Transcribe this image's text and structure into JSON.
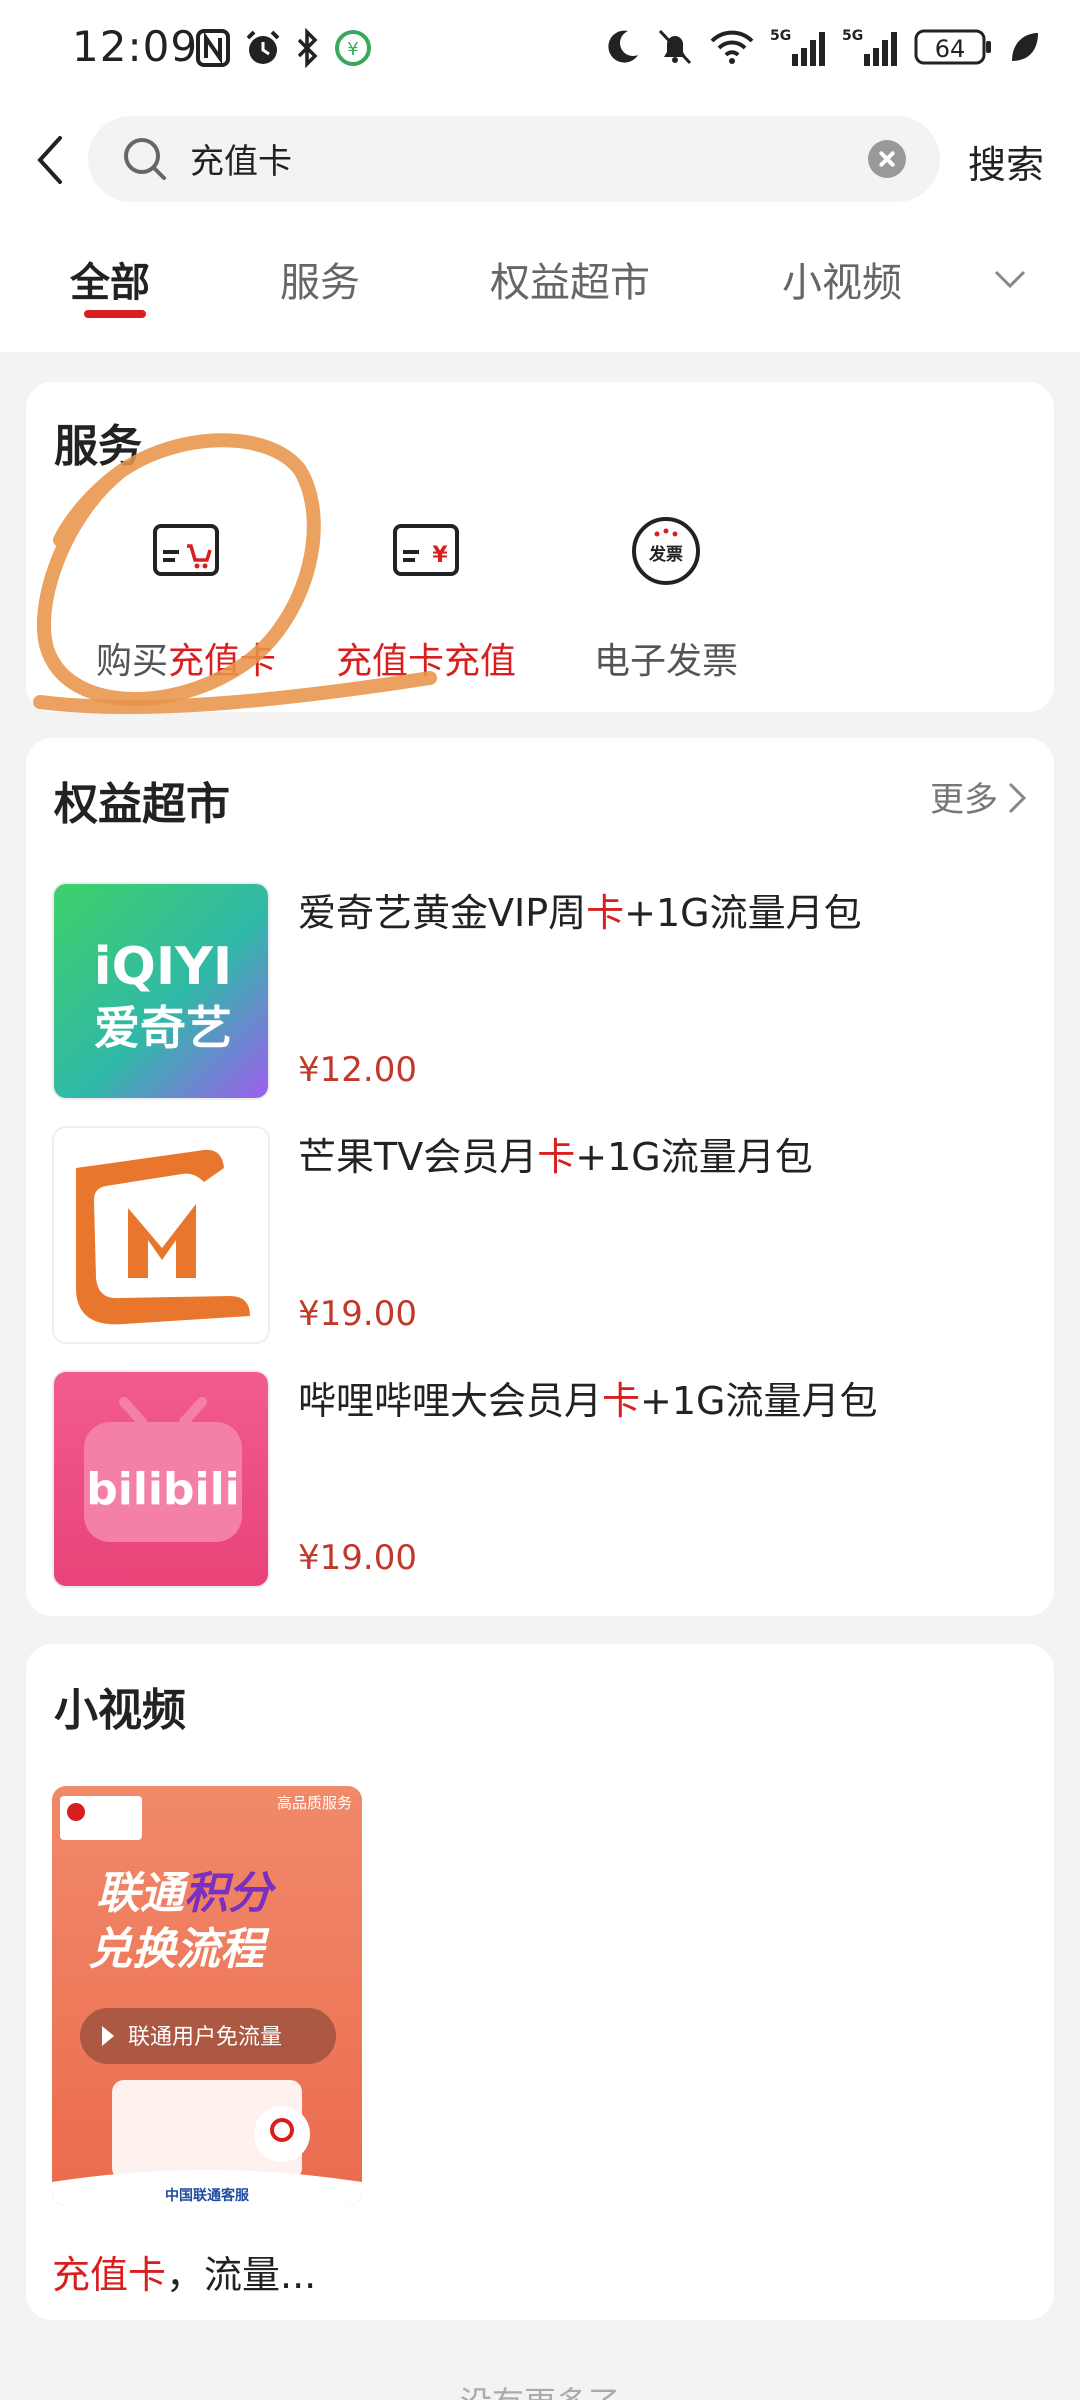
{
  "status_bar": {
    "time": "12:09",
    "left_icons": [
      "nfc-icon",
      "alarm-icon",
      "bluetooth-icon",
      "wallet-icon"
    ],
    "right_icons": [
      "moon-icon",
      "bell-off-icon",
      "wifi-icon",
      "signal-5g-icon",
      "signal-5g-icon"
    ],
    "battery": "64"
  },
  "search": {
    "value": "充值卡",
    "button_label": "搜索"
  },
  "tabs": [
    {
      "label": "全部",
      "active": true
    },
    {
      "label": "服务",
      "active": false
    },
    {
      "label": "权益超市",
      "active": false
    },
    {
      "label": "小视频",
      "active": false
    }
  ],
  "services": {
    "title": "服务",
    "items": [
      {
        "label_plain": "购买",
        "label_highlight": "充值卡",
        "icon": "card-cart-icon"
      },
      {
        "label_highlight": "充值卡",
        "label_highlight_2": "充值",
        "icon": "card-yen-icon"
      },
      {
        "label_plain": "电子发票",
        "icon": "invoice-icon",
        "icon_text": "发票"
      }
    ]
  },
  "market": {
    "title": "权益超市",
    "more_label": "更多",
    "products": [
      {
        "title_before": "爱奇艺黄金VIP周",
        "title_hl": "卡",
        "title_after": "+1G流量月包",
        "price": "¥12.00",
        "thumb": "iqiyi-logo",
        "logo_line1": "iQIYI",
        "logo_line2": "爱奇艺"
      },
      {
        "title_before": "芒果TV会员月",
        "title_hl": "卡",
        "title_after": "+1G流量月包",
        "price": "¥19.00",
        "thumb": "mango-tv-logo"
      },
      {
        "title_before": "哔哩哔哩大会员月",
        "title_hl": "卡",
        "title_after": "+1G流量月包",
        "price": "¥19.00",
        "thumb": "bilibili-logo",
        "logo_text": "bilibili"
      }
    ]
  },
  "videos": {
    "title": "小视频",
    "items": [
      {
        "thumb_badge": "高品质服务",
        "thumb_headline_1a": "联通",
        "thumb_headline_1b": "积分",
        "thumb_headline_2": "兑换流程",
        "thumb_pill": "联通用户免流量",
        "thumb_footer": "中国联通客服",
        "caption_hl": "充值卡",
        "caption_rest": "，流量..."
      }
    ]
  },
  "footer": "没有更多了",
  "colors": {
    "accent": "#d81e1e",
    "price": "#c0392b",
    "annotation": "#e8944a"
  }
}
